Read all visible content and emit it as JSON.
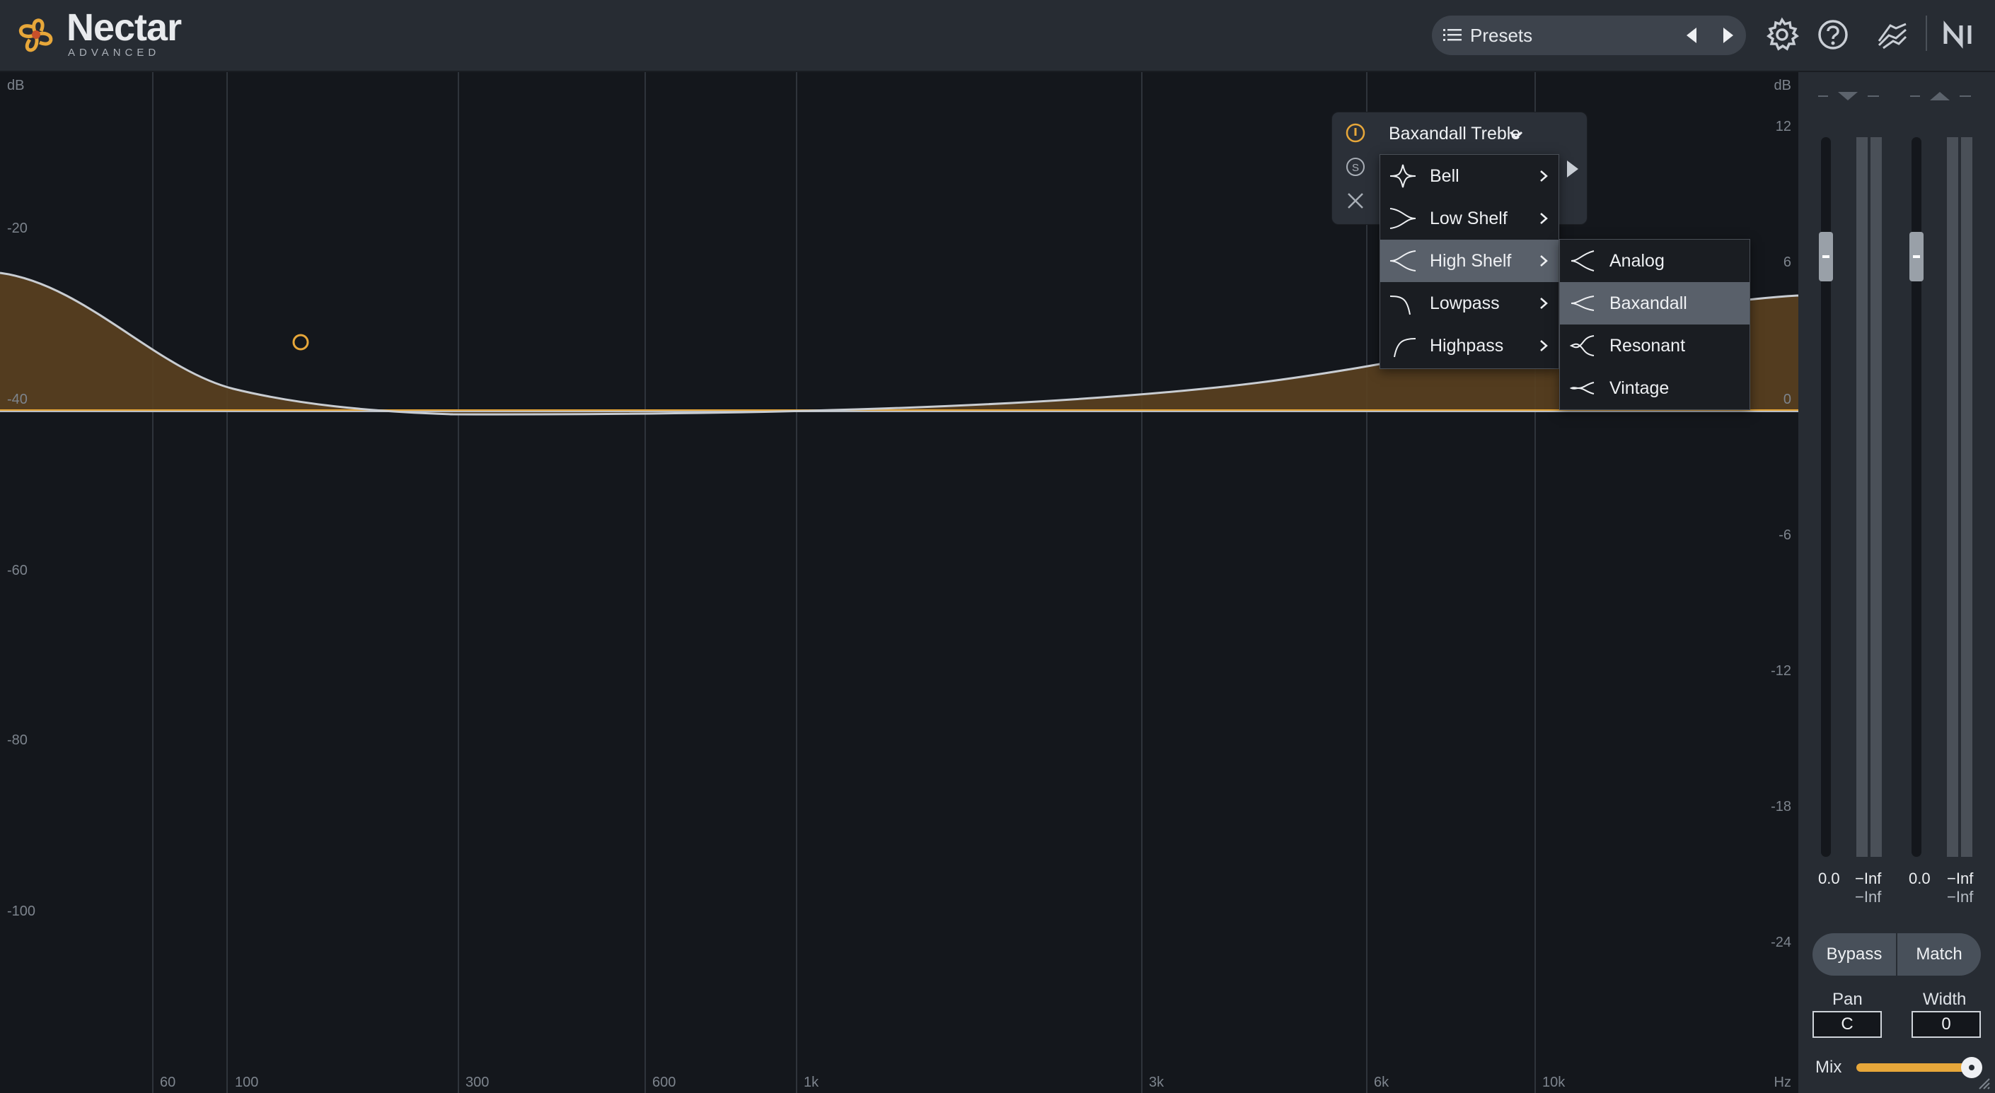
{
  "app": {
    "name": "Nectar",
    "subtitle": "ADVANCED"
  },
  "header": {
    "presets_label": "Presets",
    "icons": [
      "list-icon",
      "prev-arrow-icon",
      "next-arrow-icon",
      "gear-icon",
      "help-icon",
      "signal-chain-icon",
      "ni-logo-icon"
    ]
  },
  "eq": {
    "left_unit": "dB",
    "left_scale": [
      "-20",
      "-40",
      "-60",
      "-80",
      "-100"
    ],
    "right_unit": "dB",
    "right_scale": [
      "12",
      "6",
      "0",
      "-6",
      "-12",
      "-18",
      "-24"
    ],
    "freq_labels": [
      "60",
      "100",
      "300",
      "600",
      "1k",
      "3k",
      "6k",
      "10k"
    ],
    "freq_unit": "Hz"
  },
  "band_panel": {
    "type_label": "Baxandall Treble",
    "icons": [
      "power-icon",
      "solo-icon",
      "close-icon",
      "chevron-down-icon",
      "play-icon"
    ]
  },
  "filter_menu": {
    "items": [
      {
        "label": "Bell",
        "icon": "bell-shape-icon"
      },
      {
        "label": "Low Shelf",
        "icon": "low-shelf-shape-icon"
      },
      {
        "label": "High Shelf",
        "icon": "high-shelf-shape-icon",
        "highlighted": true
      },
      {
        "label": "Lowpass",
        "icon": "lowpass-shape-icon"
      },
      {
        "label": "Highpass",
        "icon": "highpass-shape-icon"
      }
    ]
  },
  "submenu": {
    "items": [
      {
        "label": "Analog",
        "icon": "analog-shelf-icon"
      },
      {
        "label": "Baxandall",
        "icon": "baxandall-shelf-icon",
        "highlighted": true
      },
      {
        "label": "Resonant",
        "icon": "resonant-shelf-icon"
      },
      {
        "label": "Vintage",
        "icon": "vintage-shelf-icon"
      }
    ]
  },
  "meters": {
    "input_gain": "0.0",
    "input_peak_top": "−Inf",
    "input_peak_bottom": "−Inf",
    "output_gain": "0.0",
    "output_peak_top": "−Inf",
    "output_peak_bottom": "−Inf"
  },
  "buttons": {
    "bypass": "Bypass",
    "match": "Match"
  },
  "pan": {
    "label": "Pan",
    "value": "C"
  },
  "width": {
    "label": "Width",
    "value": "0"
  },
  "mix": {
    "label": "Mix",
    "level": 1.0
  },
  "colors": {
    "accent": "#e7a73a",
    "fill": "#5a4020",
    "background": "#14171c",
    "panel": "#272c33",
    "highlight": "#59606a"
  }
}
